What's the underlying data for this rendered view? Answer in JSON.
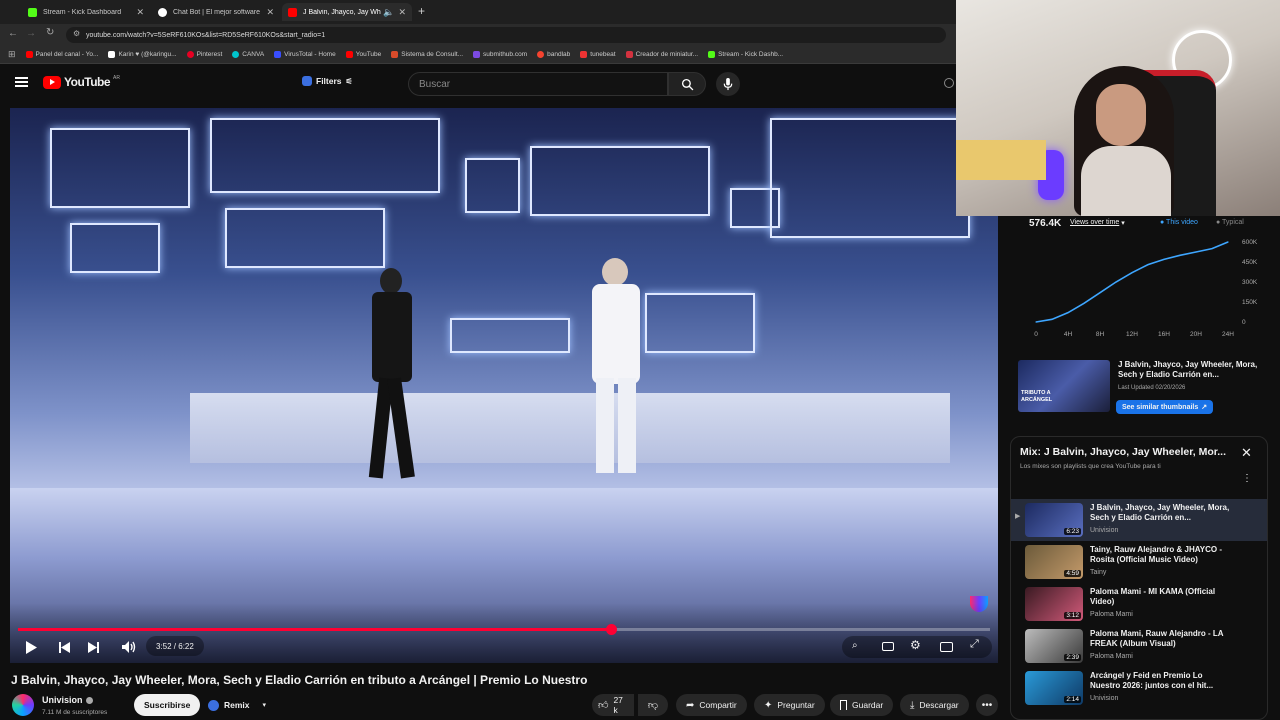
{
  "browser": {
    "tabs": [
      {
        "title": "Stream - Kick Dashboard",
        "color": "#53fc18"
      },
      {
        "title": "Chat Bot | El mejor software pa",
        "color": "#ffffff"
      },
      {
        "title": "J Balvin, Jhayco, Jay Wheele",
        "color": "#ff0000"
      }
    ],
    "url": "youtube.com/watch?v=5SeRF610KOs&list=RD5SeRF610KOs&start_radio=1",
    "bookmarks": [
      {
        "label": "Panel del canal - Yo...",
        "color": "#ff0000"
      },
      {
        "label": "Karin ♥ (@karingu...",
        "color": "#ffffff"
      },
      {
        "label": "Pinterest",
        "color": "#e60023"
      },
      {
        "label": "CANVA",
        "color": "#00c4cc"
      },
      {
        "label": "VirusTotal - Home",
        "color": "#394eff"
      },
      {
        "label": "YouTube",
        "color": "#ff0000"
      },
      {
        "label": "Sistema de Consult...",
        "color": "#d84b2a"
      },
      {
        "label": "submithub.com",
        "color": "#7b4ae2"
      },
      {
        "label": "bandlab",
        "color": "#f5432f"
      },
      {
        "label": "tunebeat",
        "color": "#e33"
      },
      {
        "label": "Creador de miniatur...",
        "color": "#d3323f"
      },
      {
        "label": "Stream - Kick Dashb...",
        "color": "#53fc18"
      }
    ]
  },
  "header": {
    "logo_text": "YouTube",
    "region": "AR",
    "filters_label": "Filters",
    "search_placeholder": "Buscar"
  },
  "player": {
    "time": "3:52 / 6:22",
    "progress": 0.61
  },
  "video": {
    "title": "J Balvin, Jhayco, Jay Wheeler, Mora, Sech y Eladio Carrión en tributo a Arcángel | Premio Lo Nuestro",
    "channel": "Univision",
    "subscribers": "7.11 M de suscriptores",
    "subscribe_label": "Suscribirse",
    "remix_label": "Remix",
    "likes": "27 k",
    "share_label": "Compartir",
    "ask_label": "Preguntar",
    "save_label": "Guardar",
    "download_label": "Descargar"
  },
  "analytics": {
    "views": "576.4K",
    "metric_label": "Views over time",
    "legend_this": "This video",
    "legend_typical": "Typical",
    "colors": {
      "line": "#3ea6ff",
      "typical": "#777777"
    }
  },
  "chart_data": {
    "type": "line",
    "x": [
      0,
      2,
      4,
      6,
      8,
      10,
      12,
      14,
      16,
      18,
      20,
      22,
      24
    ],
    "series": [
      {
        "values": [
          0,
          20,
          70,
          140,
          220,
          300,
          370,
          430,
          470,
          500,
          525,
          550,
          600
        ]
      }
    ],
    "xticks": [
      "0",
      "4H",
      "8H",
      "12H",
      "16H",
      "20H",
      "24H"
    ],
    "yticks": [
      "0",
      "150K",
      "300K",
      "450K",
      "600K"
    ],
    "ylim": [
      0,
      600
    ],
    "xlim": [
      0,
      24
    ]
  },
  "thumbnail_card": {
    "title": "J Balvin, Jhayco, Jay Wheeler, Mora, Sech y Eladio Carrión en...",
    "updated": "Last Updated 02/20/2026",
    "thumb_text": "TRIBUTO A ARCÁNGEL",
    "button": "See similar thumbnails"
  },
  "mix": {
    "title": "Mix: J Balvin, Jhayco, Jay Wheeler, Mor...",
    "subtitle": "Los mixes son playlists que crea YouTube para ti",
    "items": [
      {
        "title": "J Balvin, Jhayco, Jay Wheeler, Mora, Sech y Eladio Carrión en...",
        "channel": "Univision",
        "duration": "6:23",
        "current": true
      },
      {
        "title": "Tainy, Rauw Alejandro & JHAYCO - Rosita (Official Music Video)",
        "channel": "Tainy",
        "duration": "4:59",
        "current": false
      },
      {
        "title": "Paloma Mami - MI KAMA (Official Video)",
        "channel": "Paloma Mami",
        "duration": "3:12",
        "current": false
      },
      {
        "title": "Paloma Mami, Rauw Alejandro - LA FREAK (Album Visual)",
        "channel": "Paloma Mami",
        "duration": "2:39",
        "current": false
      },
      {
        "title": "Arcángel y Feid en Premio Lo Nuestro 2026: juntos con el hit...",
        "channel": "Univision",
        "duration": "2:14",
        "current": false
      }
    ]
  }
}
